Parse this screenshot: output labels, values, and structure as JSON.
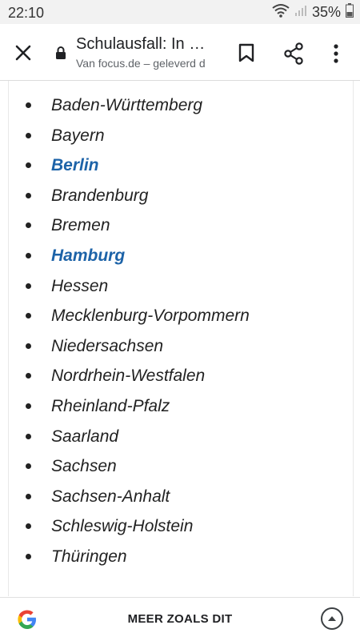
{
  "statusbar": {
    "time": "22:10",
    "battery": "35%",
    "icons": [
      "wifi-icon",
      "signal-icon",
      "battery-icon"
    ]
  },
  "toolbar": {
    "title": "Schulausfall: In w…",
    "subtitle": "Van focus.de – geleverd d",
    "icons": [
      "close-icon",
      "lock-icon",
      "bookmark-icon",
      "share-icon",
      "more-vert-icon"
    ]
  },
  "states": [
    {
      "label": "Baden-Württemberg",
      "link": false
    },
    {
      "label": "Bayern",
      "link": false
    },
    {
      "label": "Berlin",
      "link": true
    },
    {
      "label": "Brandenburg",
      "link": false
    },
    {
      "label": "Bremen",
      "link": false
    },
    {
      "label": "Hamburg",
      "link": true
    },
    {
      "label": "Hessen",
      "link": false
    },
    {
      "label": "Mecklenburg-Vorpommern",
      "link": false
    },
    {
      "label": "Niedersachsen",
      "link": false
    },
    {
      "label": "Nordrhein-Westfalen",
      "link": false
    },
    {
      "label": "Rheinland-Pfalz",
      "link": false
    },
    {
      "label": "Saarland",
      "link": false
    },
    {
      "label": "Sachsen",
      "link": false
    },
    {
      "label": "Sachsen-Anhalt",
      "link": false
    },
    {
      "label": "Schleswig-Holstein",
      "link": false
    },
    {
      "label": "Thüringen",
      "link": false
    }
  ],
  "bottombar": {
    "label": "MEER ZOALS DIT",
    "icons": [
      "google-icon",
      "expand-up-icon"
    ]
  },
  "colors": {
    "link": "#1d63a8",
    "text": "#222222",
    "statusbar_bg": "#f2f2f2"
  }
}
